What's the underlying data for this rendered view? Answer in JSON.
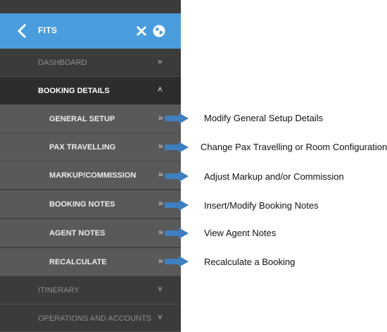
{
  "header": {
    "title": "FITS",
    "accent_color": "#4a9ddc",
    "icons": [
      "chevron-left-icon",
      "close-icon",
      "globe-icon"
    ]
  },
  "menu": {
    "dashboard": {
      "label": "DASHBOARD",
      "chevron": "»"
    },
    "booking_details": {
      "label": "BOOKING DETAILS",
      "chevron": "˄"
    },
    "sub_items": [
      {
        "label": "GENERAL SETUP",
        "chevron": "»",
        "annotation": "Modify General Setup Details"
      },
      {
        "label": "PAX TRAVELLING",
        "chevron": "»",
        "annotation": "Change Pax Travelling or Room Configuration"
      },
      {
        "label": "MARKUP/COMMISSION",
        "chevron": "»",
        "annotation": "Adjust Markup and/or Commission"
      },
      {
        "label": "BOOKING NOTES",
        "chevron": "»",
        "annotation": "Insert/Modify Booking Notes"
      },
      {
        "label": "AGENT NOTES",
        "chevron": "»",
        "annotation": "View Agent Notes"
      },
      {
        "label": "RECALCULATE",
        "chevron": "»",
        "annotation": "Recalculate a Booking"
      }
    ],
    "itinerary": {
      "label": "ITINERARY",
      "chevron": "˅"
    },
    "operations": {
      "label": "OPERATIONS AND ACCOUNTS",
      "chevron": "˅"
    }
  },
  "colors": {
    "panel_bg": "#3b3b3b",
    "active_bg": "#2d2d2d",
    "sub_bg": "#595959",
    "callout_arrow": "#3d7fbf"
  }
}
